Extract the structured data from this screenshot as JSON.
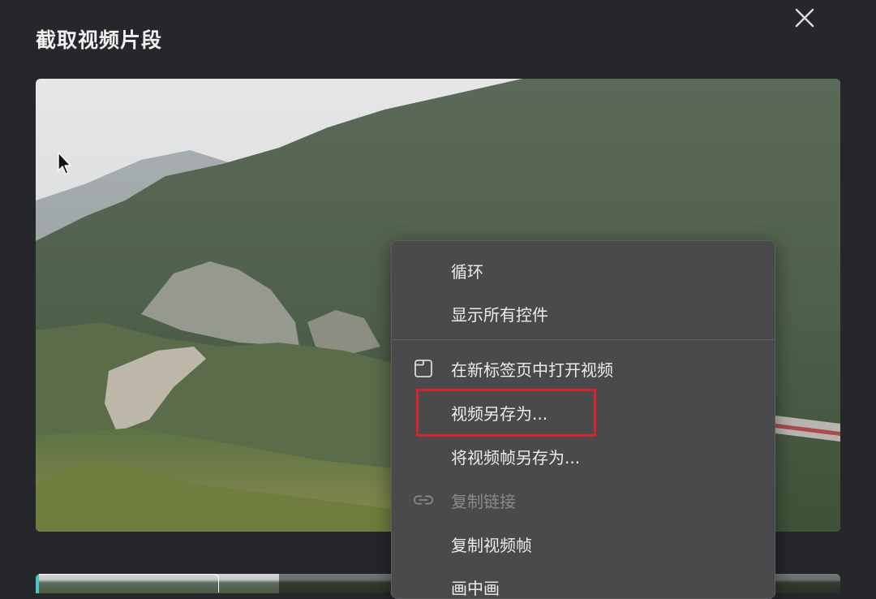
{
  "dialog": {
    "title": "截取视频片段"
  },
  "icons": {
    "close": "close-icon",
    "cursor": "mouse-pointer-icon",
    "new_tab": "new-tab-icon",
    "link": "link-icon"
  },
  "context_menu": {
    "items": [
      {
        "label": "循环",
        "enabled": true
      },
      {
        "label": "显示所有控件",
        "enabled": true
      },
      {
        "label": "在新标签页中打开视频",
        "enabled": true,
        "icon": "new-tab-icon"
      },
      {
        "label": "视频另存为...",
        "enabled": true,
        "highlighted": true
      },
      {
        "label": "将视频帧另存为...",
        "enabled": true
      },
      {
        "label": "复制链接",
        "enabled": false,
        "icon": "link-icon"
      },
      {
        "label": "复制视频帧",
        "enabled": true
      },
      {
        "label": "画中画",
        "enabled": true
      }
    ]
  },
  "colors": {
    "background": "#25272b",
    "menu_background": "#4a4a4c",
    "highlight_border": "#d8232a",
    "selection_handle": "#4cc6c0"
  }
}
